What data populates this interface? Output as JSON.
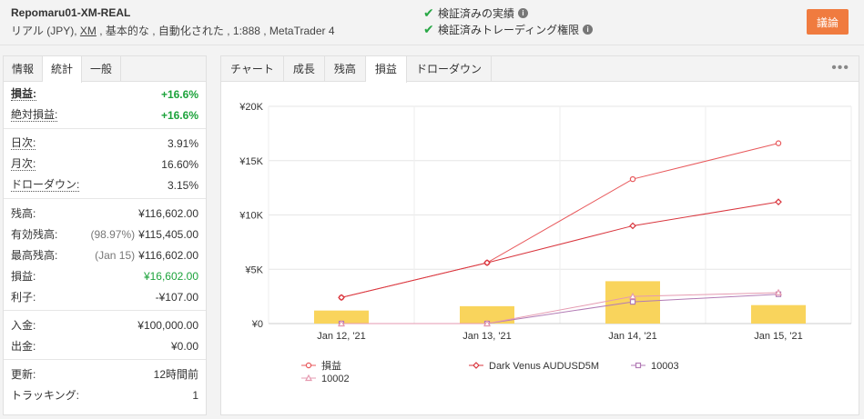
{
  "header": {
    "account_name": "Repomaru01-XM-REAL",
    "desc_prefix": "リアル (JPY), ",
    "broker": "XM",
    "desc_suffix": " , 基本的な , 自動化された , 1:888 , MetaTrader 4",
    "verified_track": "検証済みの実績",
    "verified_trading": "検証済みトレーディング権限",
    "discuss_label": "議論"
  },
  "left_tabs": [
    "情報",
    "統計",
    "一般"
  ],
  "left_active_tab": 1,
  "stats": {
    "gain_label": "損益:",
    "gain_value": "+16.6%",
    "abs_gain_label": "絶対損益:",
    "abs_gain_value": "+16.6%",
    "daily_label": "日次:",
    "daily_value": "3.91%",
    "monthly_label": "月次:",
    "monthly_value": "16.60%",
    "drawdown_label": "ドローダウン:",
    "drawdown_value": "3.15%",
    "balance_label": "残高:",
    "balance_value": "¥116,602.00",
    "equity_label": "有効残高:",
    "equity_note": "(98.97%)",
    "equity_value": "¥115,405.00",
    "highest_label": "最高残高:",
    "highest_note": "(Jan 15)",
    "highest_value": "¥116,602.00",
    "profit_label": "損益:",
    "profit_value": "¥16,602.00",
    "interest_label": "利子:",
    "interest_value": "-¥107.00",
    "deposits_label": "入金:",
    "deposits_value": "¥100,000.00",
    "withdrawals_label": "出金:",
    "withdrawals_value": "¥0.00",
    "updated_label": "更新:",
    "updated_value": "12時間前",
    "tracking_label": "トラッキング:",
    "tracking_value": "1"
  },
  "right_tabs": [
    "チャート",
    "成長",
    "残高",
    "損益",
    "ドローダウン"
  ],
  "right_active_tab": 3,
  "more_icon": "more-dots-icon",
  "chart_data": {
    "type": "bar",
    "categories": [
      "Jan 12, '21",
      "Jan 13, '21",
      "Jan 14, '21",
      "Jan 15, '21"
    ],
    "ylim": [
      0,
      20000
    ],
    "yticks": [
      0,
      5000,
      10000,
      15000,
      20000
    ],
    "ytick_labels": [
      "¥0",
      "¥5K",
      "¥10K",
      "¥15K",
      "¥20K"
    ],
    "bar_values": [
      1200,
      1600,
      3900,
      1700
    ],
    "bar_color": "#f9d45c",
    "series": [
      {
        "name": "損益",
        "values": [
          2400,
          5600,
          13300,
          16600
        ],
        "color": "#e8595c",
        "marker": "circle"
      },
      {
        "name": "Dark Venus AUDUSD5M",
        "values": [
          2400,
          5600,
          9000,
          11200
        ],
        "color": "#d9363e",
        "marker": "diamond"
      },
      {
        "name": "10003",
        "values": [
          0,
          0,
          2000,
          2700
        ],
        "color": "#b27bb5",
        "marker": "square"
      },
      {
        "name": "10002",
        "values": [
          0,
          0,
          2500,
          2850
        ],
        "color": "#e59ab0",
        "marker": "triangle"
      }
    ]
  }
}
